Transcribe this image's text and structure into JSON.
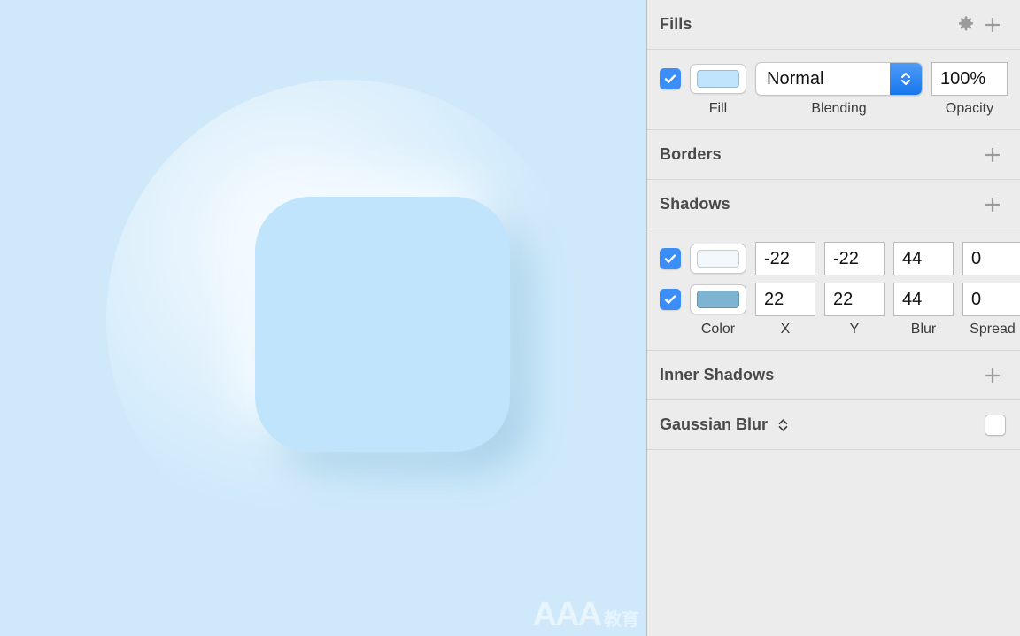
{
  "canvas": {
    "background_color": "#cfe9fb",
    "shape": {
      "name": "neumorphic-rounded-square",
      "fill_color": "#bfe4fc",
      "corner_radius": 62,
      "light_shadow_color": "#f4fbff",
      "dark_shadow_color": "#a9d2ea"
    },
    "watermark": {
      "text": "AAA",
      "subtext": "教育"
    }
  },
  "inspector": {
    "fills": {
      "title": "Fills",
      "gear_icon": "gear-icon",
      "add_icon": "plus-icon",
      "row": {
        "enabled": true,
        "fill_color": "#bfe4fc",
        "blending": "Normal",
        "opacity": "100%"
      },
      "labels": {
        "fill": "Fill",
        "blending": "Blending",
        "opacity": "Opacity"
      }
    },
    "borders": {
      "title": "Borders",
      "add_icon": "plus-icon"
    },
    "shadows": {
      "title": "Shadows",
      "add_icon": "plus-icon",
      "labels": {
        "color": "Color",
        "x": "X",
        "y": "Y",
        "blur": "Blur",
        "spread": "Spread"
      },
      "rows": [
        {
          "enabled": true,
          "color": "#f2f8fc",
          "x": "-22",
          "y": "-22",
          "blur": "44",
          "spread": "0"
        },
        {
          "enabled": true,
          "color": "#7eb4d2",
          "x": "22",
          "y": "22",
          "blur": "44",
          "spread": "0"
        }
      ]
    },
    "inner_shadows": {
      "title": "Inner Shadows",
      "add_icon": "plus-icon"
    },
    "gaussian_blur": {
      "title": "Gaussian Blur",
      "chevron_icon": "chevron-updown-icon",
      "enabled": false
    }
  },
  "theme": {
    "panel_background": "#ececec",
    "accent_blue": "#3b8ef5",
    "divider": "#d6d6d6",
    "header_text": "#4a4a4a"
  }
}
